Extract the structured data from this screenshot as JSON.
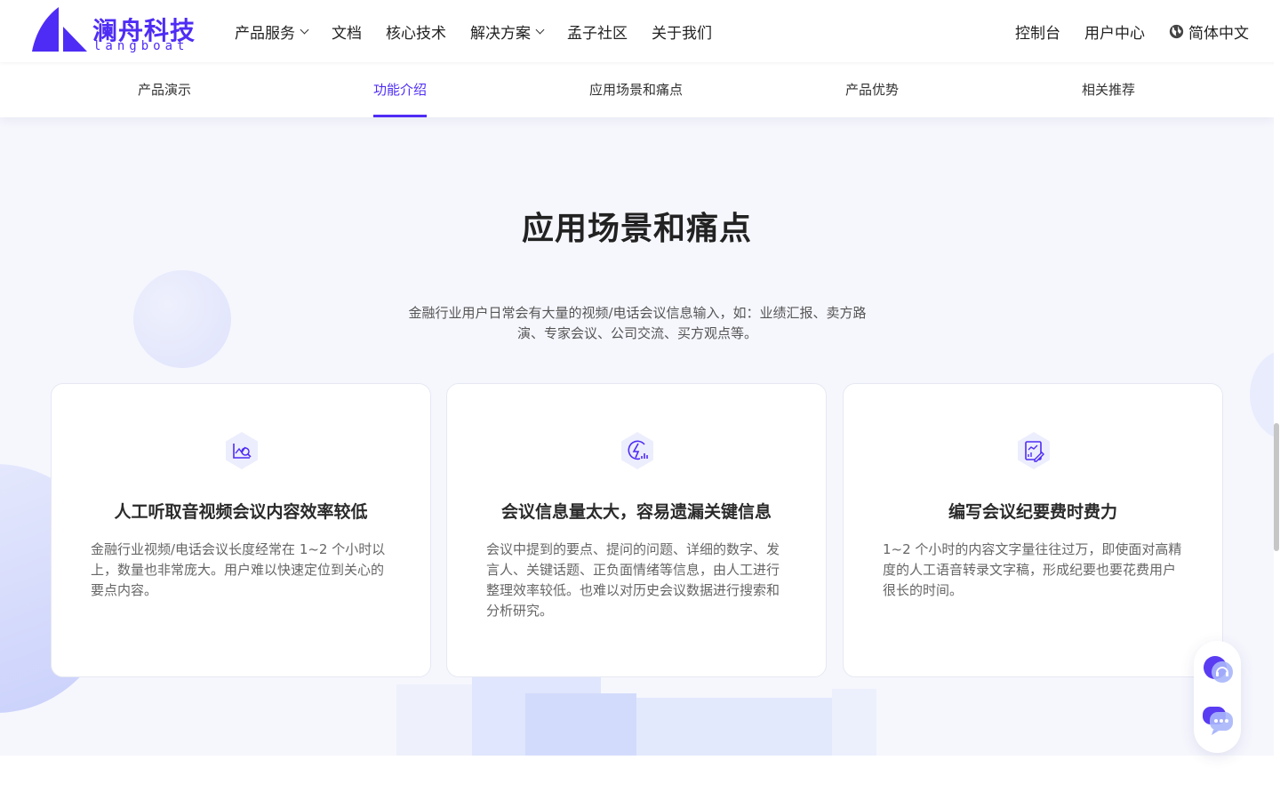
{
  "logo": {
    "cn": "澜舟科技",
    "en": "langboat"
  },
  "nav": {
    "items": [
      {
        "label": "产品服务",
        "dropdown": true
      },
      {
        "label": "文档",
        "dropdown": false
      },
      {
        "label": "核心技术",
        "dropdown": false
      },
      {
        "label": "解决方案",
        "dropdown": true
      },
      {
        "label": "孟子社区",
        "dropdown": false
      },
      {
        "label": "关于我们",
        "dropdown": false
      }
    ],
    "console": "控制台",
    "user_center": "用户中心",
    "language": "简体中文"
  },
  "tabs": [
    {
      "label": "产品演示",
      "active": false
    },
    {
      "label": "功能介绍",
      "active": true
    },
    {
      "label": "应用场景和痛点",
      "active": false
    },
    {
      "label": "产品优势",
      "active": false
    },
    {
      "label": "相关推荐",
      "active": false
    }
  ],
  "section": {
    "title": "应用场景和痛点",
    "description": "金融行业用户日常会有大量的视频/电话会议信息输入，如：业绩汇报、卖方路演、专家会议、公司交流、买方观点等。",
    "cards": [
      {
        "icon": "chart-search-icon",
        "title": "人工听取音视频会议内容效率较低",
        "text": "金融行业视频/电话会议长度经常在 1~2 个小时以上，数量也非常庞大。用户难以快速定位到关心的要点内容。"
      },
      {
        "icon": "lightning-data-icon",
        "title": "会议信息量太大，容易遗漏关键信息",
        "text": "会议中提到的要点、提问的问题、详细的数字、发言人、关键话题、正负面情绪等信息，由人工进行整理效率较低。也难以对历史会议数据进行搜索和分析研究。"
      },
      {
        "icon": "document-edit-icon",
        "title": "编写会议纪要费时费力",
        "text": "1~2 个小时的内容文字量往往过万，即使面对高精度的人工语音转录文字稿，形成纪要也要花费用户很长的时间。"
      }
    ]
  },
  "colors": {
    "accent": "#4f2cf5",
    "section_bg": "#f6f7fd",
    "icon_bg": "#eceefd"
  }
}
